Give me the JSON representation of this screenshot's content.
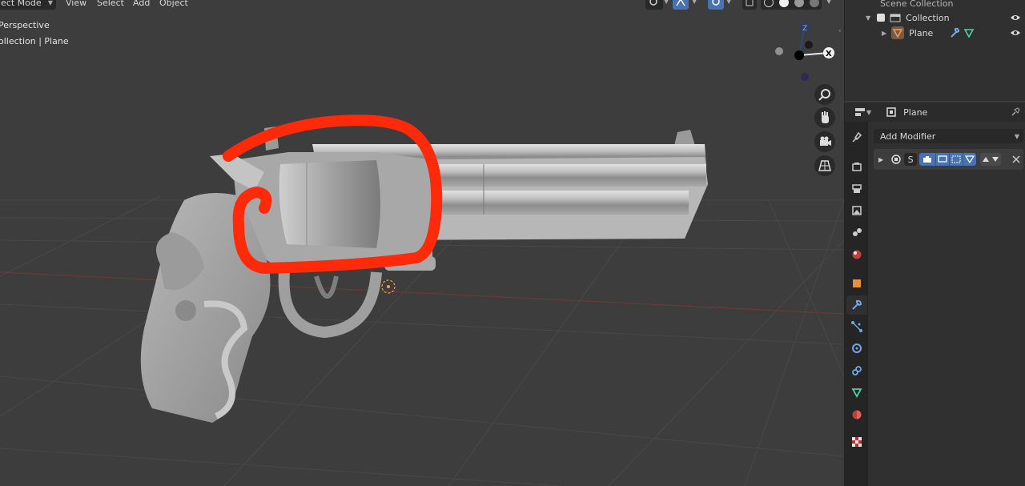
{
  "viewport": {
    "header": {
      "mode_label": "ject Mode",
      "menus": [
        "View",
        "Select",
        "Add",
        "Object"
      ]
    },
    "overlay": {
      "view_name": "Perspective",
      "collection_path": "ollection | Plane"
    },
    "gizmo": {
      "z_label": "Z",
      "x_label": "X"
    },
    "annotation": {
      "color": "#ff2a0a"
    }
  },
  "outliner": {
    "root_label": "Scene Collection",
    "collection_label": "Collection",
    "object_label": "Plane"
  },
  "properties": {
    "object_name": "Plane",
    "add_modifier_label": "Add Modifier",
    "modifier_name_initial": "S",
    "active_tab": "modifier"
  },
  "colors": {
    "accent_blue": "#4772b3",
    "viewport_bg": "#3d3d3d",
    "panel_bg": "#303030",
    "mesh_icon_green": "#4fd2a0",
    "annotation_red": "#ff2a0a"
  }
}
